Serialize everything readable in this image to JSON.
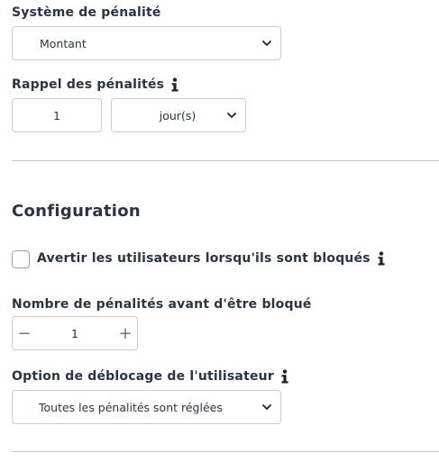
{
  "penalty_system": {
    "label": "Système de pénalité",
    "selected": "Montant"
  },
  "penalty_reminder": {
    "label": "Rappel des pénalités",
    "value": "1",
    "unit_selected": "jour(s)"
  },
  "configuration": {
    "title": "Configuration",
    "notify_checkbox_label": "Avertir les utilisateurs lorsqu'ils sont bloqués",
    "notify_checked": false,
    "penalties_before_block": {
      "label": "Nombre de pénalités avant d'être bloqué",
      "value": "1",
      "minus": "−",
      "plus": "+"
    },
    "unblock_option": {
      "label": "Option de déblocage de l'utilisateur",
      "selected": "Toutes les pénalités sont réglées"
    }
  },
  "icons": {
    "info": "info-icon",
    "dropdown": "chevron-down-icon"
  },
  "colors": {
    "text": "#2b3440",
    "border": "#c9ccd1",
    "divider": "#c7cace"
  }
}
